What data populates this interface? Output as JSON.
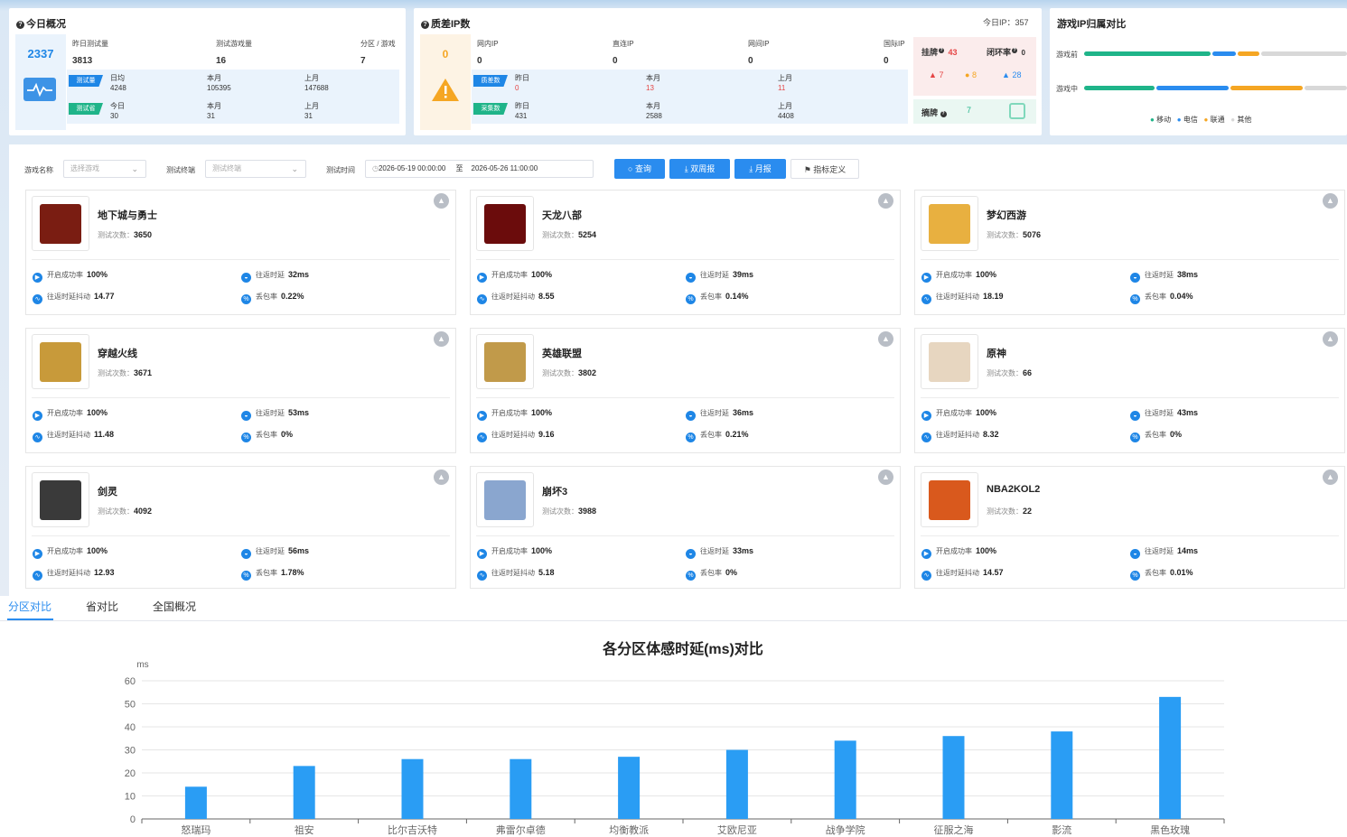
{
  "today": {
    "title": "今日概况",
    "total": "2337",
    "col1": "昨日测试量",
    "col2": "测试游戏量",
    "col3": "分区 / 游戏",
    "v1": "3813",
    "v2": "16",
    "v3": "7",
    "tag_test": "测试量",
    "tag_game": "测试省",
    "daily_avg": "日均",
    "this_month": "本月",
    "last_month": "上月",
    "today_lbl": "今日",
    "r1": [
      "4248",
      "105395",
      "147688"
    ],
    "r2": [
      "30",
      "31",
      "31"
    ]
  },
  "badip": {
    "title": "质差IP数",
    "today_ip": "今日IP：357",
    "count": "0",
    "c1": "网内IP",
    "c2": "直连IP",
    "c3": "网间IP",
    "c4": "国际IP",
    "v": [
      "0",
      "0",
      "0",
      "0"
    ],
    "tag1": "质差数",
    "tag2": "采集数",
    "yesterday": "昨日",
    "this_month": "本月",
    "last_month": "上月",
    "r1": [
      "0",
      "13",
      "11"
    ],
    "r2": [
      "431",
      "2588",
      "4408"
    ],
    "guapai": "挂牌",
    "guapai_n": "43",
    "bihuan": "闭环率",
    "bihuan_n": "0",
    "s1": "7",
    "s2": "8",
    "s3": "28",
    "zhaipai": "摘牌",
    "zhaipai_n": "7"
  },
  "ipcompare": {
    "title": "游戏IP归属对比",
    "row1": "游戏前",
    "row2": "游戏中",
    "legend": [
      "移动",
      "电信",
      "联通",
      "其他"
    ],
    "colors": [
      "#1fb489",
      "#2a8cef",
      "#f5a623",
      "#d8d8d8"
    ]
  },
  "filter": {
    "game_lbl": "游戏名称",
    "game_ph": "选择游戏",
    "term_lbl": "测试终端",
    "term_ph": "测试终端",
    "time_lbl": "测试时间",
    "start": "2026-05-19 00:00:00",
    "to": "至",
    "end": "2026-05-26 11:00:00",
    "query": "查询",
    "weekly": "双周报",
    "monthly": "月报",
    "define": "指标定义"
  },
  "labels": {
    "count": "测试次数：",
    "succ": "开启成功率",
    "rtt": "往返时延",
    "jitter": "往返时延抖动",
    "loss": "丢包率"
  },
  "games": [
    {
      "name": "地下城与勇士",
      "count": "3650",
      "succ": "100%",
      "rtt": "32ms",
      "jitter": "14.77",
      "loss": "0.22%",
      "icon": "dnf-logo",
      "bg": "#7a1d12"
    },
    {
      "name": "天龙八部",
      "count": "5254",
      "succ": "100%",
      "rtt": "39ms",
      "jitter": "8.55",
      "loss": "0.14%",
      "icon": "tlbb-logo",
      "bg": "#6b0c0c"
    },
    {
      "name": "梦幻西游",
      "count": "5076",
      "succ": "100%",
      "rtt": "38ms",
      "jitter": "18.19",
      "loss": "0.04%",
      "icon": "mhxy-logo",
      "bg": "#e8b040"
    },
    {
      "name": "穿越火线",
      "count": "3671",
      "succ": "100%",
      "rtt": "53ms",
      "jitter": "11.48",
      "loss": "0%",
      "icon": "cf-logo",
      "bg": "#c89a3a"
    },
    {
      "name": "英雄联盟",
      "count": "3802",
      "succ": "100%",
      "rtt": "36ms",
      "jitter": "9.16",
      "loss": "0.21%",
      "icon": "lol-logo",
      "bg": "#c19a4a"
    },
    {
      "name": "原神",
      "count": "66",
      "succ": "100%",
      "rtt": "43ms",
      "jitter": "8.32",
      "loss": "0%",
      "icon": "genshin-logo",
      "bg": "#e7d6c0"
    },
    {
      "name": "剑灵",
      "count": "4092",
      "succ": "100%",
      "rtt": "56ms",
      "jitter": "12.93",
      "loss": "1.78%",
      "icon": "bns-logo",
      "bg": "#3a3a3a"
    },
    {
      "name": "崩坏3",
      "count": "3988",
      "succ": "100%",
      "rtt": "33ms",
      "jitter": "5.18",
      "loss": "0%",
      "icon": "honkai-logo",
      "bg": "#8aa6cf"
    },
    {
      "name": "NBA2KOL2",
      "count": "22",
      "succ": "100%",
      "rtt": "14ms",
      "jitter": "14.57",
      "loss": "0.01%",
      "icon": "nba2k-logo",
      "bg": "#d9591d"
    }
  ],
  "tabs": [
    "分区对比",
    "省对比",
    "全国概况"
  ],
  "chart_data": {
    "type": "bar",
    "title": "各分区体感时延(ms)对比",
    "ylabel": "ms",
    "ylim": [
      0,
      60
    ],
    "yticks": [
      "0",
      "10",
      "20",
      "30",
      "40",
      "50",
      "60"
    ],
    "categories": [
      "怒瑞玛",
      "祖安",
      "比尔吉沃特",
      "弗雷尔卓德",
      "均衡教派",
      "艾欧尼亚",
      "战争学院",
      "征服之海",
      "影流",
      "黑色玫瑰"
    ],
    "values": [
      14,
      23,
      26,
      26,
      27,
      30,
      34,
      36,
      38,
      53
    ],
    "color": "#2a9df4"
  }
}
